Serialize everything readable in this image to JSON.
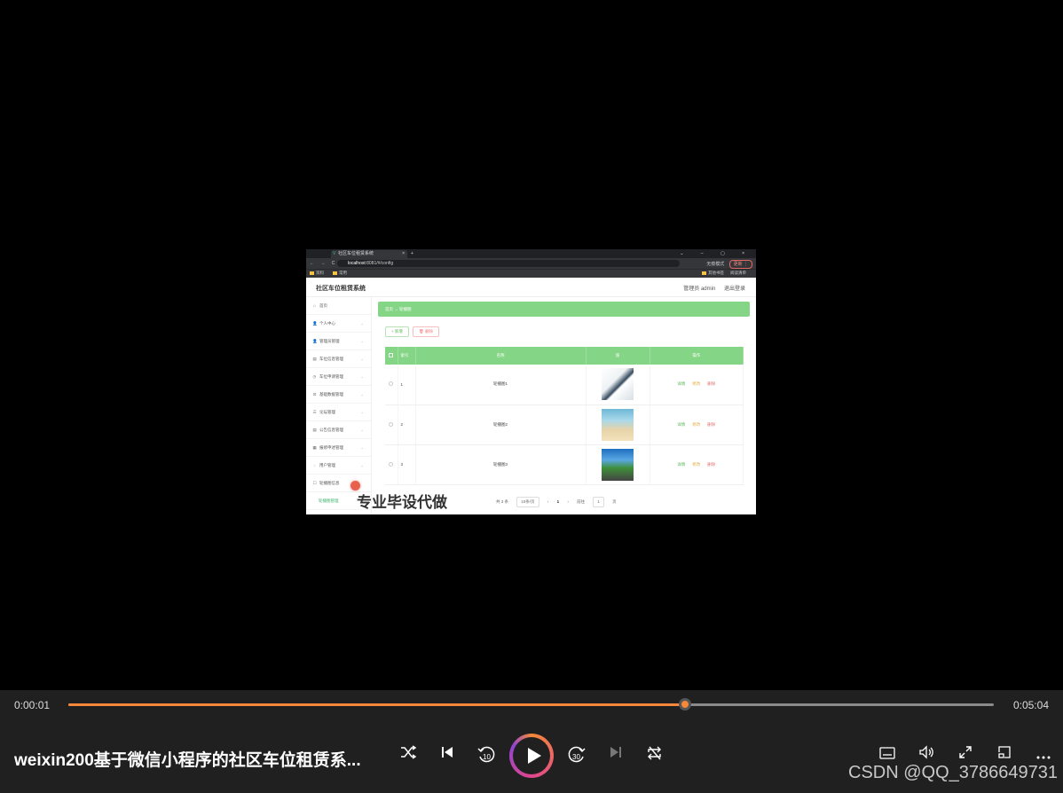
{
  "browser": {
    "tab_title": "社区车位租赁系统",
    "tab_close": "×",
    "new_tab": "+",
    "window_controls": "⌄ – ▢ ×",
    "nav": "← → C",
    "url_host": "localhost",
    "url_path": ":8081/#/config",
    "incognito": "无痕模式",
    "update": "更新 ⋮",
    "bookmarks": [
      "资料",
      "常用"
    ],
    "bookmarks_right": [
      "其他书签",
      "阅读清单"
    ]
  },
  "app": {
    "title": "社区车位租赁系统",
    "role": "管理员 admin",
    "logout": "退出登录",
    "sidebar": [
      {
        "icon": "⌂",
        "label": "首页"
      },
      {
        "icon": "👤",
        "label": "个人中心",
        "chev": "⌄"
      },
      {
        "icon": "👤",
        "label": "管理员管理",
        "chev": "⌄"
      },
      {
        "icon": "▤",
        "label": "车位信息管理",
        "chev": "⌄"
      },
      {
        "icon": "◷",
        "label": "车位申请管理",
        "chev": "⌄"
      },
      {
        "icon": "⊡",
        "label": "基础数据管理",
        "chev": "⌄"
      },
      {
        "icon": "☰",
        "label": "论坛管理",
        "chev": "⌄"
      },
      {
        "icon": "▤",
        "label": "公告信息管理",
        "chev": "⌄"
      },
      {
        "icon": "▦",
        "label": "报修申述管理",
        "chev": "⌄"
      },
      {
        "icon": "◌",
        "label": "用户管理",
        "chev": "⌄"
      },
      {
        "icon": "☐",
        "label": "轮播图信息",
        "chev": ""
      }
    ],
    "sidebar_sub": "轮播图管理",
    "breadcrumb": "首页 → 轮播图",
    "btn_add": "+ 新增",
    "btn_delete": "🗑 删除",
    "table": {
      "headers": [
        "索引",
        "名称",
        "值",
        "操作"
      ],
      "rows": [
        {
          "index": "1",
          "name": "轮播图1"
        },
        {
          "index": "2",
          "name": "轮播图2"
        },
        {
          "index": "3",
          "name": "轮播图3"
        }
      ],
      "actions": [
        "详情",
        "修改",
        "删除"
      ]
    },
    "pager": {
      "total": "共 3 条",
      "per_page": "10条/页",
      "prev": "‹",
      "page": "1",
      "next": "›",
      "goto": "前往",
      "goto_page": "1",
      "page_unit": "页"
    }
  },
  "overlay": {
    "watermark": "专业毕设代做"
  },
  "player": {
    "current_time": "0:00:01",
    "total_time": "0:05:04",
    "progress_fraction": 0.666,
    "title": "weixin200基于微信小程序的社区车位租赁系...",
    "accent": "#f5883a",
    "icons": [
      "shuffle-icon",
      "previous-icon",
      "rewind-10-icon",
      "play-icon",
      "forward-30-icon",
      "next-icon",
      "repeat-icon",
      "subtitles-icon",
      "volume-icon",
      "fullscreen-icon",
      "miniplayer-icon",
      "more-icon"
    ],
    "rewind_label": "10",
    "forward_label": "30"
  },
  "credit": "CSDN @QQ_3786649731"
}
